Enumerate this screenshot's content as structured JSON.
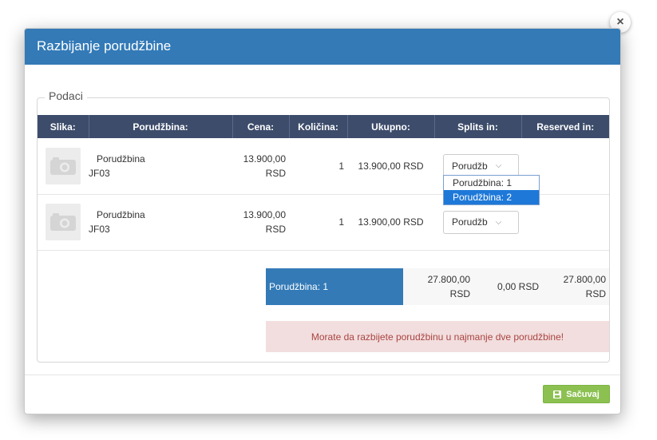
{
  "modal": {
    "title": "Razbijanje porudžbine",
    "close_label": "×"
  },
  "fieldset": {
    "legend": "Podaci"
  },
  "table": {
    "headers": [
      "Slika:",
      "Porudžbina:",
      "Cena:",
      "Količina:",
      "Ukupno:",
      "Splits in:",
      "Reserved in:"
    ],
    "rows": [
      {
        "name_line1": "Porudžbina",
        "name_line2": "JF03",
        "price_line1": "13.900,00",
        "price_line2": "RSD",
        "qty": "1",
        "total": "13.900,00 RSD",
        "split_value": "Porudžb",
        "reserved": ""
      },
      {
        "name_line1": "Porudžbina",
        "name_line2": "JF03",
        "price_line1": "13.900,00",
        "price_line2": "RSD",
        "qty": "1",
        "total": "13.900,00 RSD",
        "split_value": "Porudžb",
        "reserved": ""
      }
    ],
    "dropdown_options": [
      "Porudžbina: 1",
      "Porudžbina: 2"
    ],
    "dropdown_selected": "Porudžbina: 2"
  },
  "summary": {
    "label": "Porudžbina: 1",
    "amount_line1": "27.800,00",
    "amount_line2": "RSD",
    "zero": "0,00 RSD",
    "reserved_line1": "27.800,00",
    "reserved_line2": "RSD"
  },
  "alert": {
    "message": "Morate da razbijete porudžbinu u najmanje dve porudžbine!"
  },
  "footer": {
    "save_label": "Sačuvaj"
  },
  "colors": {
    "header": "#337ab7",
    "table_header": "#3d4c6b",
    "save": "#8cc152",
    "alert_bg": "#f2dede",
    "alert_text": "#a94442",
    "dropdown_selected": "#1e78d8"
  },
  "icons": {
    "thumbnail": "camera-placeholder-icon",
    "select_arrow": "chevron-down-icon",
    "save": "floppy-disk-icon",
    "close": "close-icon"
  }
}
